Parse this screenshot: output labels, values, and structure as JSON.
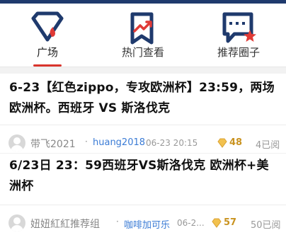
{
  "tabs": [
    {
      "label": "广场",
      "icon": "diamond-icon",
      "active": true
    },
    {
      "label": "热门查看",
      "icon": "bookmark-trend-icon",
      "active": false
    },
    {
      "label": "推荐圈子",
      "icon": "chat-star-icon",
      "active": false
    }
  ],
  "colors": {
    "brand_navy": "#1f3a6d",
    "accent_red": "#d9342c",
    "link_blue": "#3a7bd5",
    "gold": "#c99320"
  },
  "posts": [
    {
      "title": "6-23【红色zippo，专攻欧洲杯】23:59，两场欧洲杯。西班牙 VS 斯洛伐克",
      "author": "带飞2021",
      "source": "huang2018",
      "time": "06-23 20:15",
      "score": "48",
      "reads": "4已阅"
    },
    {
      "title": "6/23日 23：59西班牙VS斯洛伐克 欧洲杯+美洲杯",
      "author": "妞妞紅紅推荐组",
      "source": "咖啡加可乐",
      "time": "06-2...",
      "score": "57",
      "reads": "50已阅"
    }
  ]
}
